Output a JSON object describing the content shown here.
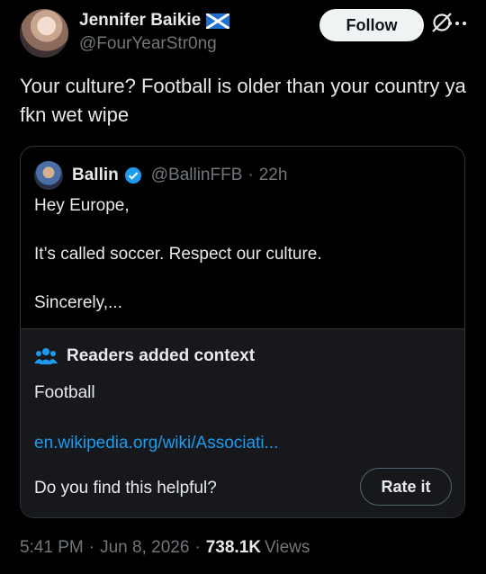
{
  "author": {
    "display_name": "Jennifer Baikie",
    "handle": "@FourYearStr0ng",
    "flag_icon": "scotland-flag-icon"
  },
  "actions": {
    "follow_label": "Follow",
    "grok_icon": "grok-icon",
    "more_icon": "more-icon"
  },
  "post": {
    "text": "Your culture? Football is older than your country ya fkn wet wipe"
  },
  "quoted_post": {
    "display_name": "Ballin",
    "handle": "@BallinFFB",
    "separator": "·",
    "time": "22h",
    "text": "Hey Europe,\n\nIt’s called soccer. Respect our culture.\n\nSincerely,..."
  },
  "community_note": {
    "title": "Readers added context",
    "body": "Football",
    "link": "en.wikipedia.org/wiki/Associati...",
    "helpful_question": "Do you find this helpful?",
    "rate_label": "Rate it"
  },
  "meta": {
    "time": "5:41 PM",
    "sep1": "·",
    "date": "Jun 8, 2026",
    "sep2": "·",
    "views_count": "738.1K",
    "views_label": "Views"
  },
  "colors": {
    "background": "#000000",
    "link": "#1d9bf0",
    "verified": "#1d9bf0",
    "muted": "#71767b"
  }
}
